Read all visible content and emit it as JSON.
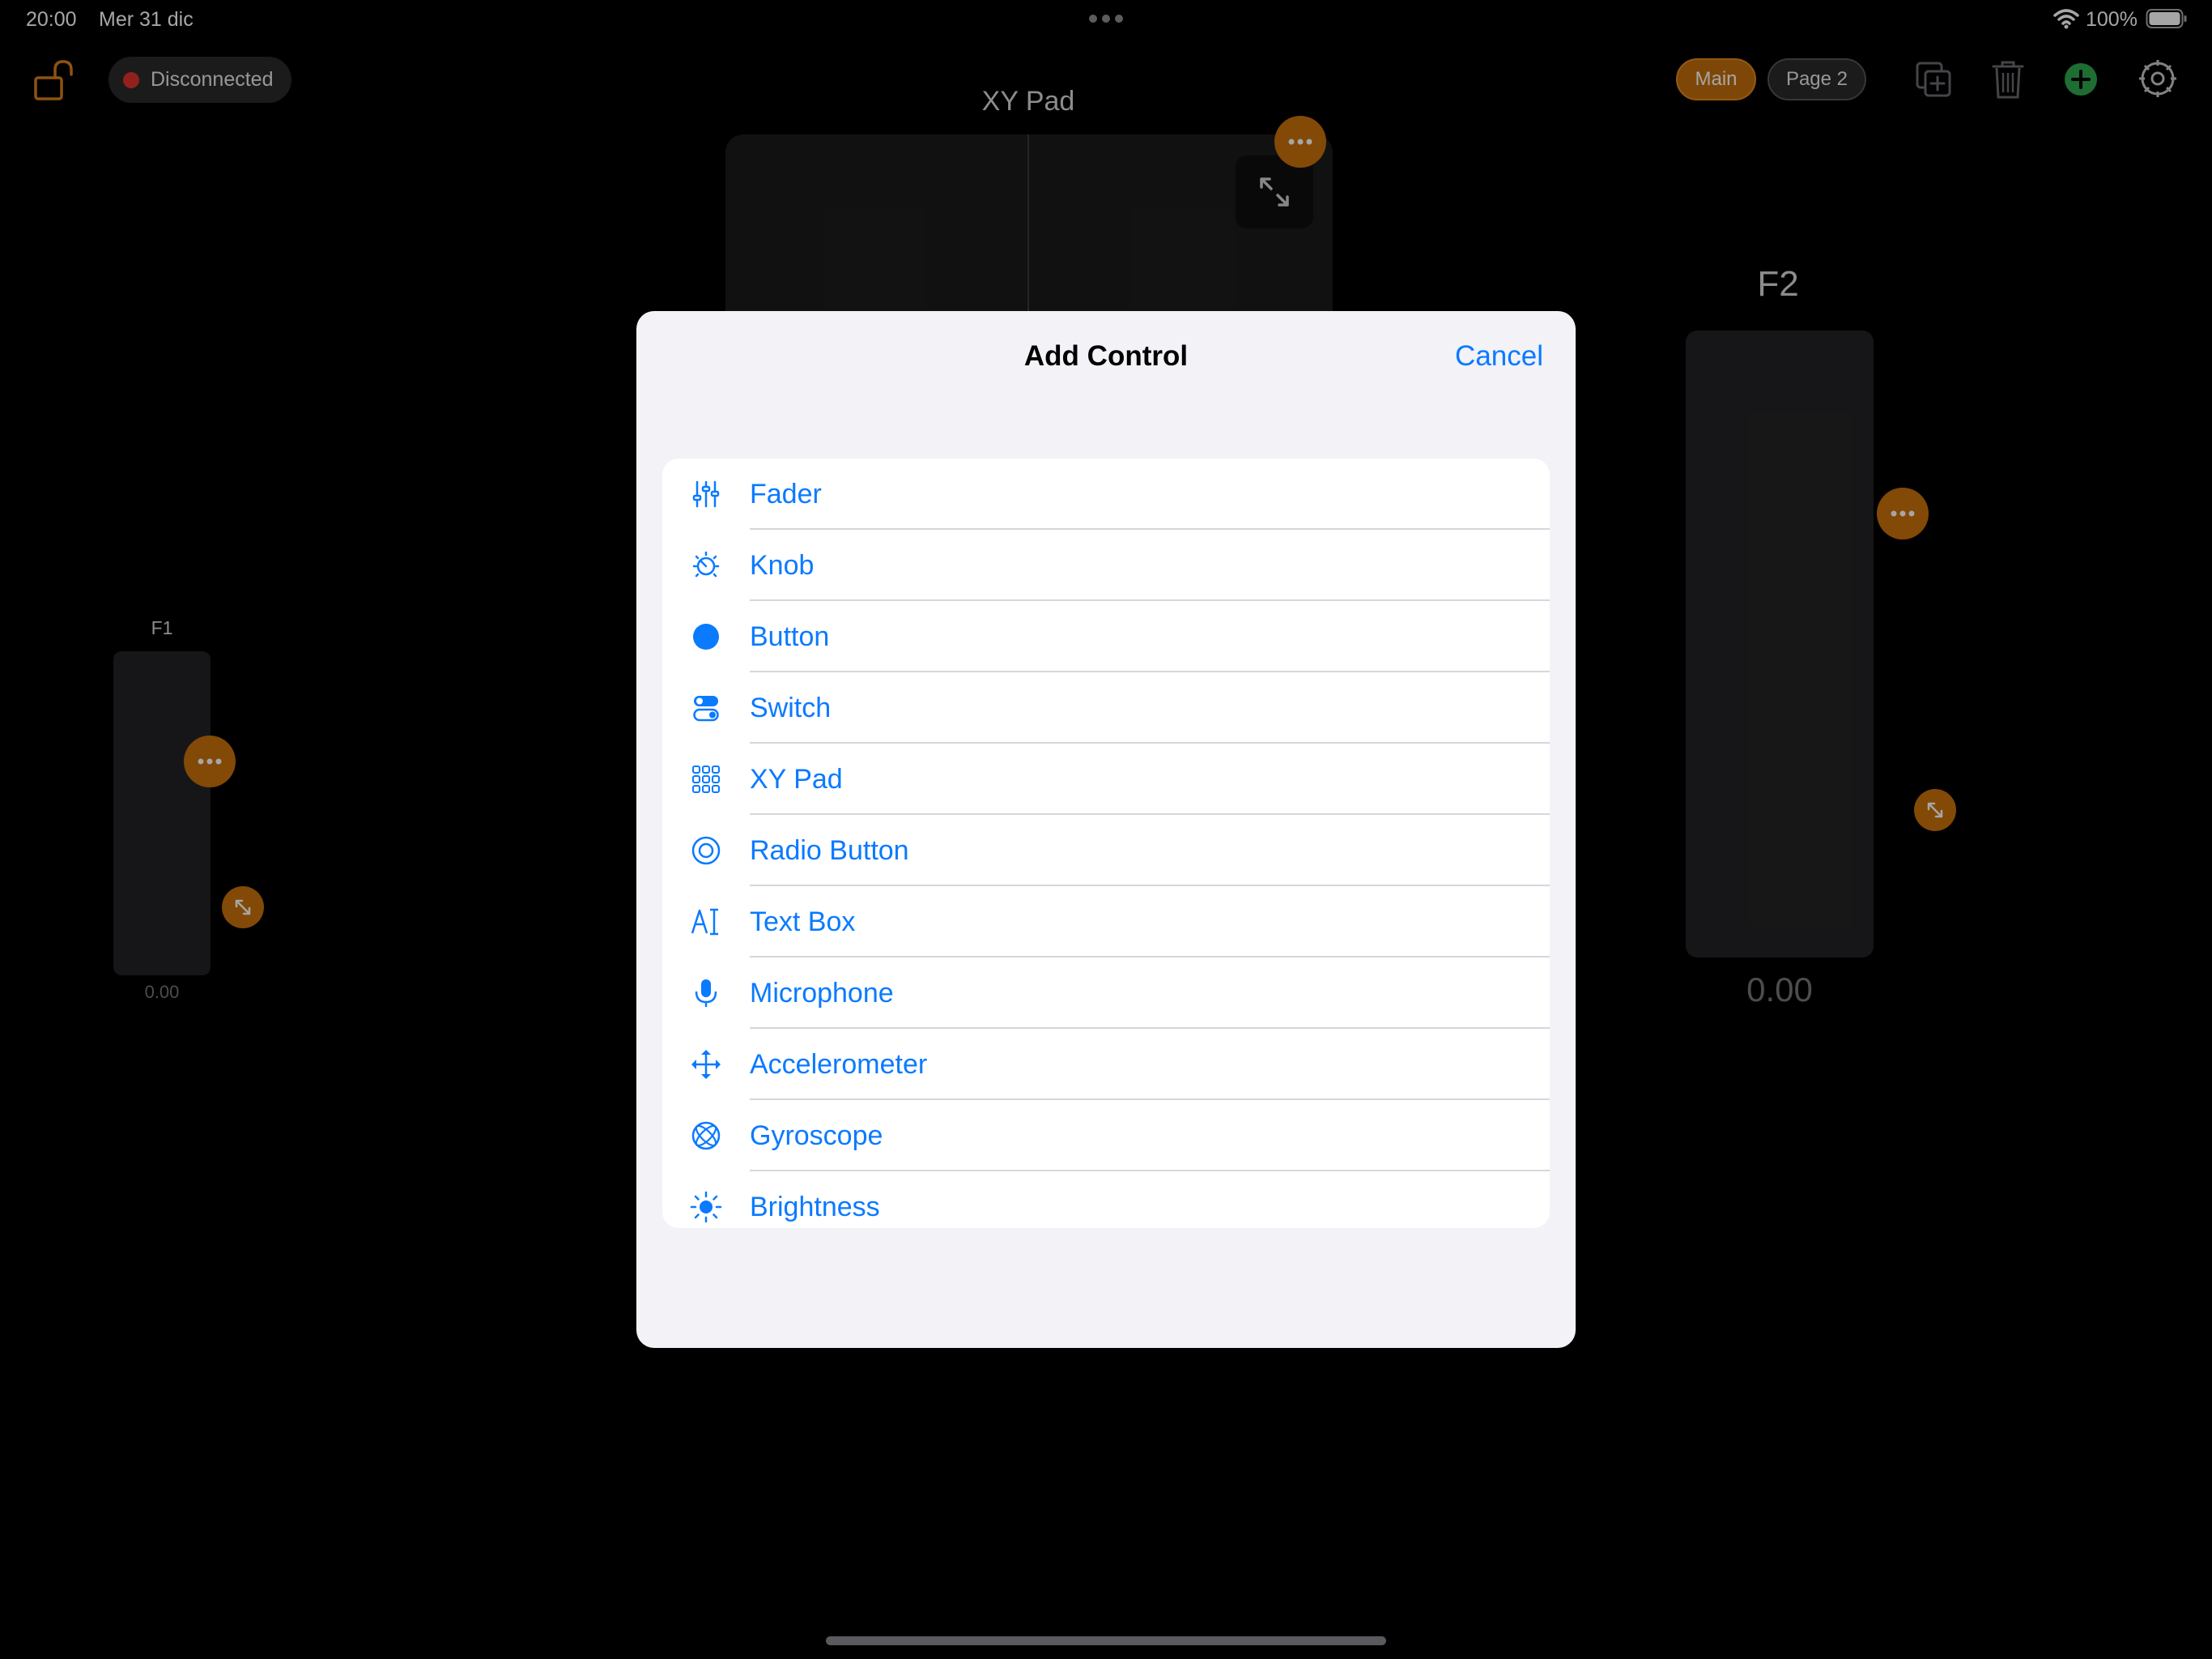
{
  "status_bar": {
    "time": "20:00",
    "date": "Mer 31 dic",
    "battery": "100%",
    "multitask_icon": "ellipsis-icon"
  },
  "toolbar": {
    "lock_icon": "unlocked-lock-icon",
    "connection_status": "Disconnected",
    "connection_color": "#e0342b",
    "pages": [
      {
        "label": "Main",
        "active": true
      },
      {
        "label": "Page 2",
        "active": false
      }
    ],
    "icons": [
      "duplicate-icon",
      "trash-icon",
      "add-icon",
      "settings-icon"
    ]
  },
  "background_controls": {
    "xy_pad": {
      "title": "XY Pad"
    },
    "fader_f1": {
      "title": "F1",
      "value": "0.00"
    },
    "fader_f2": {
      "title": "F2",
      "value": "0.00"
    }
  },
  "modal": {
    "title": "Add Control",
    "cancel_label": "Cancel",
    "items": [
      {
        "label": "Fader",
        "icon": "sliders-icon"
      },
      {
        "label": "Knob",
        "icon": "dial-icon"
      },
      {
        "label": "Button",
        "icon": "filled-circle-icon"
      },
      {
        "label": "Switch",
        "icon": "toggle-icon"
      },
      {
        "label": "XY Pad",
        "icon": "grid-icon"
      },
      {
        "label": "Radio Button",
        "icon": "radio-icon"
      },
      {
        "label": "Text Box",
        "icon": "text-cursor-icon"
      },
      {
        "label": "Microphone",
        "icon": "microphone-icon"
      },
      {
        "label": "Accelerometer",
        "icon": "move-arrows-icon"
      },
      {
        "label": "Gyroscope",
        "icon": "gyroscope-icon"
      },
      {
        "label": "Brightness",
        "icon": "sun-icon"
      }
    ]
  },
  "colors": {
    "accent_blue": "#0a7aff",
    "accent_orange": "#c8700b",
    "add_green": "#2fa84f"
  }
}
